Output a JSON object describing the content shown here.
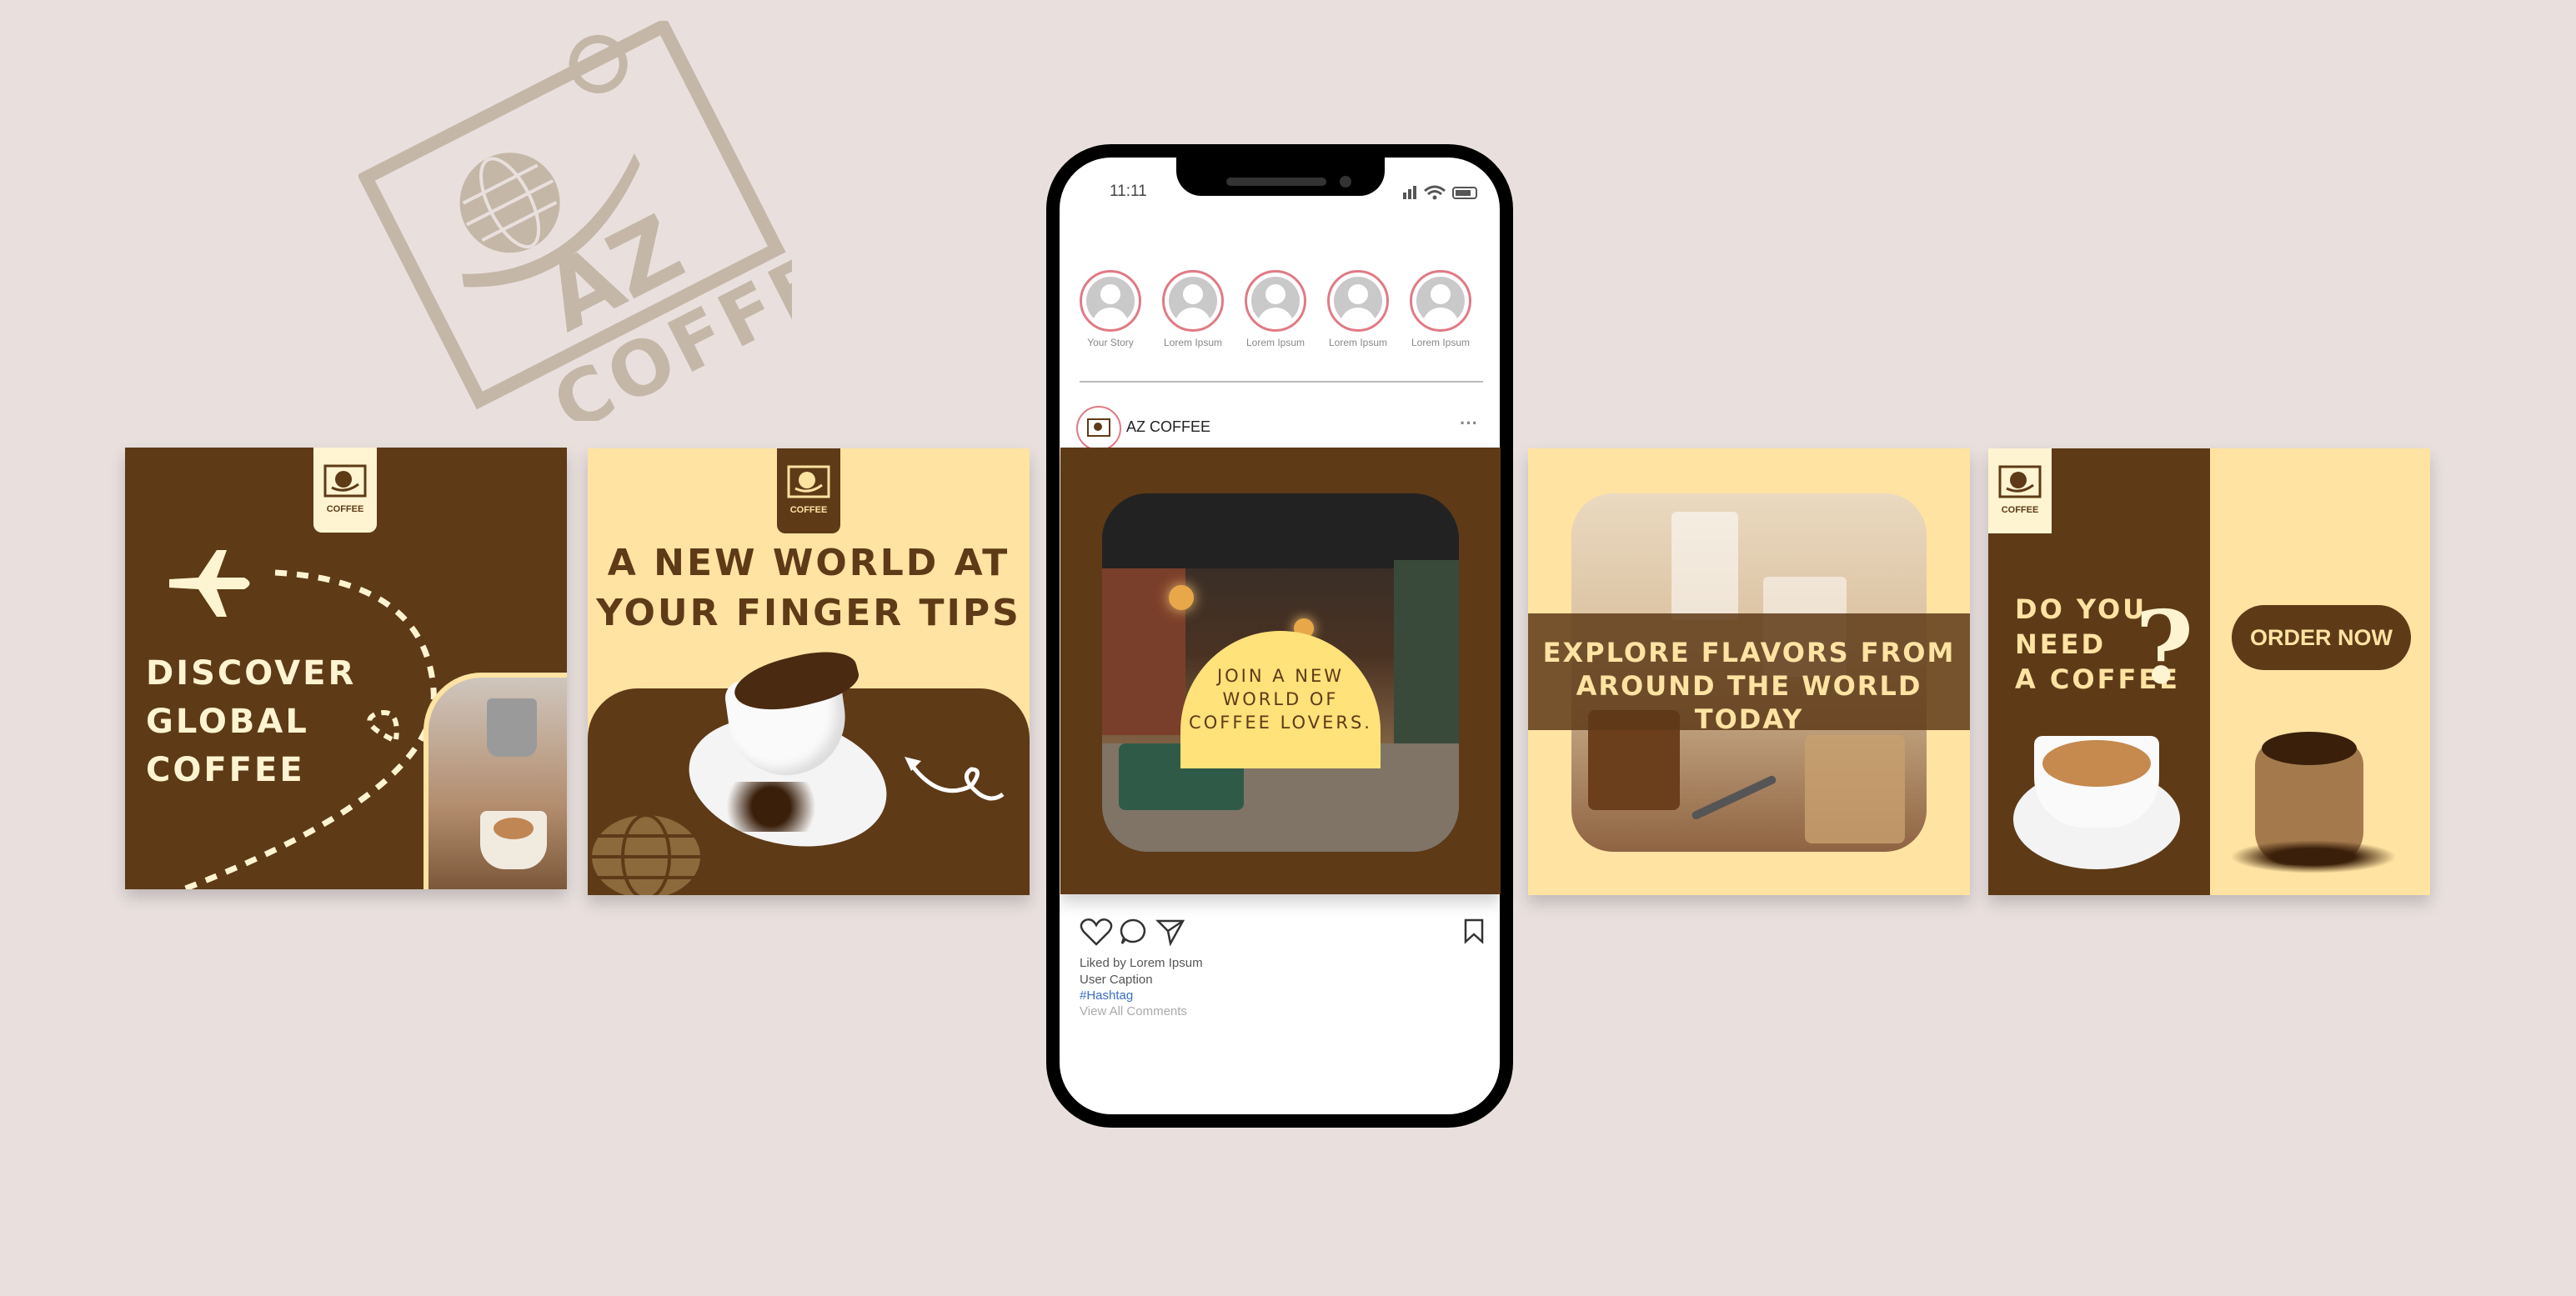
{
  "brand": {
    "name": "AZ",
    "word": "COFFEE"
  },
  "phone": {
    "status_time": "11:11",
    "stories": [
      {
        "label": "Your Story"
      },
      {
        "label": "Lorem Ipsum"
      },
      {
        "label": "Lorem Ipsum"
      },
      {
        "label": "Lorem Ipsum"
      },
      {
        "label": "Lorem Ipsum"
      }
    ],
    "post_author": "AZ COFFEE",
    "liked_by": "Liked by Lorem Ipsum",
    "user_caption": "User Caption",
    "hashtag": "#Hashtag",
    "view_comments": "View All Comments"
  },
  "panel1": {
    "lines": [
      "DISCOVER",
      "GLOBAL",
      "COFFEE"
    ]
  },
  "panel2": {
    "line1": "A NEW WORLD AT",
    "line2": "YOUR FINGER TIPS"
  },
  "panel3": {
    "lines": [
      "JOIN A NEW",
      "WORLD OF",
      "COFFEE LOVERS."
    ]
  },
  "panel4": {
    "line1": "EXPLORE FLAVORS FROM",
    "line2": "AROUND THE WORLD TODAY"
  },
  "panel5": {
    "lines": [
      "DO YOU",
      "NEED",
      "A COFFEE"
    ],
    "question": "?",
    "order_button": "ORDER NOW"
  },
  "colors": {
    "brown": "#5e3a17",
    "cream": "#ffe3a2",
    "background": "#e9e0de",
    "story_ring": "#e07a84"
  }
}
